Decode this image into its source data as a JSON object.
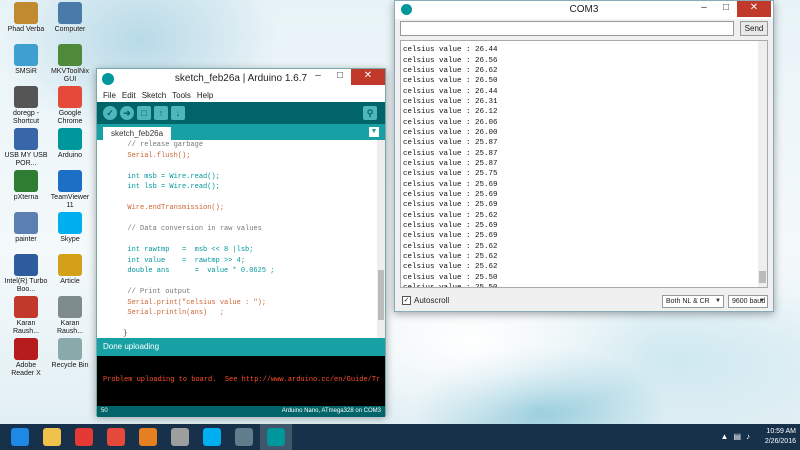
{
  "desktop": {
    "icons": [
      {
        "label": "Phad Verba",
        "color": "#c28a30"
      },
      {
        "label": "Computer",
        "color": "#4a7ba8"
      },
      {
        "label": "SMSiR",
        "color": "#3ea0cf"
      },
      {
        "label": "MKVToolNix GUI",
        "color": "#4e8a3a"
      },
      {
        "label": "doregp - Shortcut",
        "color": "#555555"
      },
      {
        "label": "Google Chrome",
        "color": "#e5493a"
      },
      {
        "label": "USB MY USB POR...",
        "color": "#3866a8"
      },
      {
        "label": "Arduino",
        "color": "#00979c"
      },
      {
        "label": "pXterna",
        "color": "#2e7d32"
      },
      {
        "label": "TeamViewer 11",
        "color": "#1d6ec5"
      },
      {
        "label": "painter",
        "color": "#5b7fb0"
      },
      {
        "label": "Skype",
        "color": "#00aff0"
      },
      {
        "label": "Intel(R) Turbo Boo...",
        "color": "#2d5d9f"
      },
      {
        "label": "Article",
        "color": "#d4a017"
      },
      {
        "label": "Karan Raush...",
        "color": "#c0392b"
      },
      {
        "label": "Karan Raush...",
        "color": "#7f8c8d"
      },
      {
        "label": "Adobe Reader X",
        "color": "#b71c1c"
      },
      {
        "label": "Recycle Bin",
        "color": "#8aa"
      }
    ]
  },
  "ide": {
    "title": "sketch_feb26a | Arduino 1.6.7",
    "menu": [
      "File",
      "Edit",
      "Sketch",
      "Tools",
      "Help"
    ],
    "tab_label": "sketch_feb26a",
    "code": [
      {
        "text": "  // release garbage",
        "cls": "comment"
      },
      {
        "text": "  Serial.flush();",
        "cls": "fn"
      },
      {
        "text": "",
        "cls": ""
      },
      {
        "text": "  int msb = Wire.read();",
        "cls": "kw"
      },
      {
        "text": "  int lsb = Wire.read();",
        "cls": "kw"
      },
      {
        "text": "",
        "cls": ""
      },
      {
        "text": "  Wire.endTransmission();",
        "cls": "fn"
      },
      {
        "text": "",
        "cls": ""
      },
      {
        "text": "  // Data conversion in raw values",
        "cls": "comment"
      },
      {
        "text": "",
        "cls": ""
      },
      {
        "text": "  int rawtmp   =  msb << 8 |lsb;",
        "cls": "kw"
      },
      {
        "text": "  int value    =  rawtmp >> 4;",
        "cls": "kw"
      },
      {
        "text": "  double ans      =  value * 0.0625 ;",
        "cls": "kw"
      },
      {
        "text": "",
        "cls": ""
      },
      {
        "text": "  // Print output",
        "cls": "comment"
      },
      {
        "text": "  Serial.print(\"celsius value : \");",
        "cls": "fn"
      },
      {
        "text": "  Serial.println(ans)   ;",
        "cls": "fn"
      },
      {
        "text": "",
        "cls": ""
      },
      {
        "text": " }",
        "cls": ""
      },
      {
        "text": "}",
        "cls": ""
      }
    ],
    "status": "Done uploading",
    "console": "Problem uploading to board.  See http://www.arduino.cc/en/Guide/Tr",
    "footer_line": "50",
    "footer_board": "Arduino Nano, ATmega328 on COM3"
  },
  "serial": {
    "title": "COM3",
    "send_label": "Send",
    "lines": [
      "celsius value : 26.62",
      "celsius value : 26.44",
      "celsius value : 26.56",
      "celsius value : 26.62",
      "celsius value : 26.50",
      "celsius value : 26.44",
      "celsius value : 26.31",
      "celsius value : 26.12",
      "celsius value : 26.06",
      "celsius value : 26.00",
      "celsius value : 25.87",
      "celsius value : 25.87",
      "celsius value : 25.87",
      "celsius value : 25.75",
      "celsius value : 25.69",
      "celsius value : 25.69",
      "celsius value : 25.69",
      "celsius value : 25.62",
      "celsius value : 25.69",
      "celsius value : 25.69",
      "celsius value : 25.62",
      "celsius value : 25.62",
      "celsius value : 25.62",
      "celsius value : 25.50",
      "celsius value : 25.50"
    ],
    "autoscroll_label": "Autoscroll",
    "line_ending": "Both NL & CR",
    "baud": "9600 baud"
  },
  "taskbar": {
    "apps": [
      {
        "name": "internet-explorer",
        "color": "#1e88e5"
      },
      {
        "name": "file-explorer",
        "color": "#f0c24b"
      },
      {
        "name": "app-red",
        "color": "#e53935"
      },
      {
        "name": "chrome",
        "color": "#e5493a"
      },
      {
        "name": "matlab",
        "color": "#e67e22"
      },
      {
        "name": "media",
        "color": "#9e9e9e"
      },
      {
        "name": "skype",
        "color": "#00aff0"
      },
      {
        "name": "monitor",
        "color": "#607d8b"
      },
      {
        "name": "arduino",
        "color": "#00979c"
      }
    ],
    "time": "10:59 AM",
    "date": "2/26/2016"
  },
  "colors": {
    "arduino_dark": "#006468",
    "arduino_teal": "#17a1a5",
    "console_error": "#ff4f29"
  }
}
